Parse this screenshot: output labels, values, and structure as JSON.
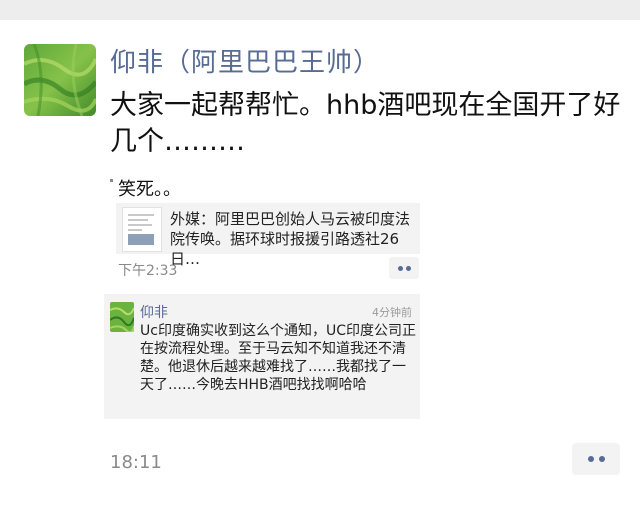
{
  "post": {
    "author": "仰非（阿里巴巴王帅）",
    "text": "大家一起帮帮忙。hhb酒吧现在全国开了好几个………",
    "avatar_icon": "green-grass-avatar",
    "time": "18:11"
  },
  "comment": {
    "text": "笑死。。"
  },
  "share": {
    "title": "外媒：阿里巴巴创始人马云被印度法院传唤。据环球时报援引路透社26日…",
    "thumb_icon": "news-thumbnail",
    "time": "下午2:33"
  },
  "reply": {
    "name": "仰非",
    "time": "4分钟前",
    "text": "Uc印度确实收到这么个通知，UC印度公司正在按流程处理。至于马云知不知道我还不清楚。他退休后越来越难找了……我都找了一天了……今晚去HHB酒吧找找啊哈哈"
  },
  "colors": {
    "link_blue": "#576b95",
    "gray_text": "#8a8a8a",
    "card_bg": "#f3f3f3"
  }
}
